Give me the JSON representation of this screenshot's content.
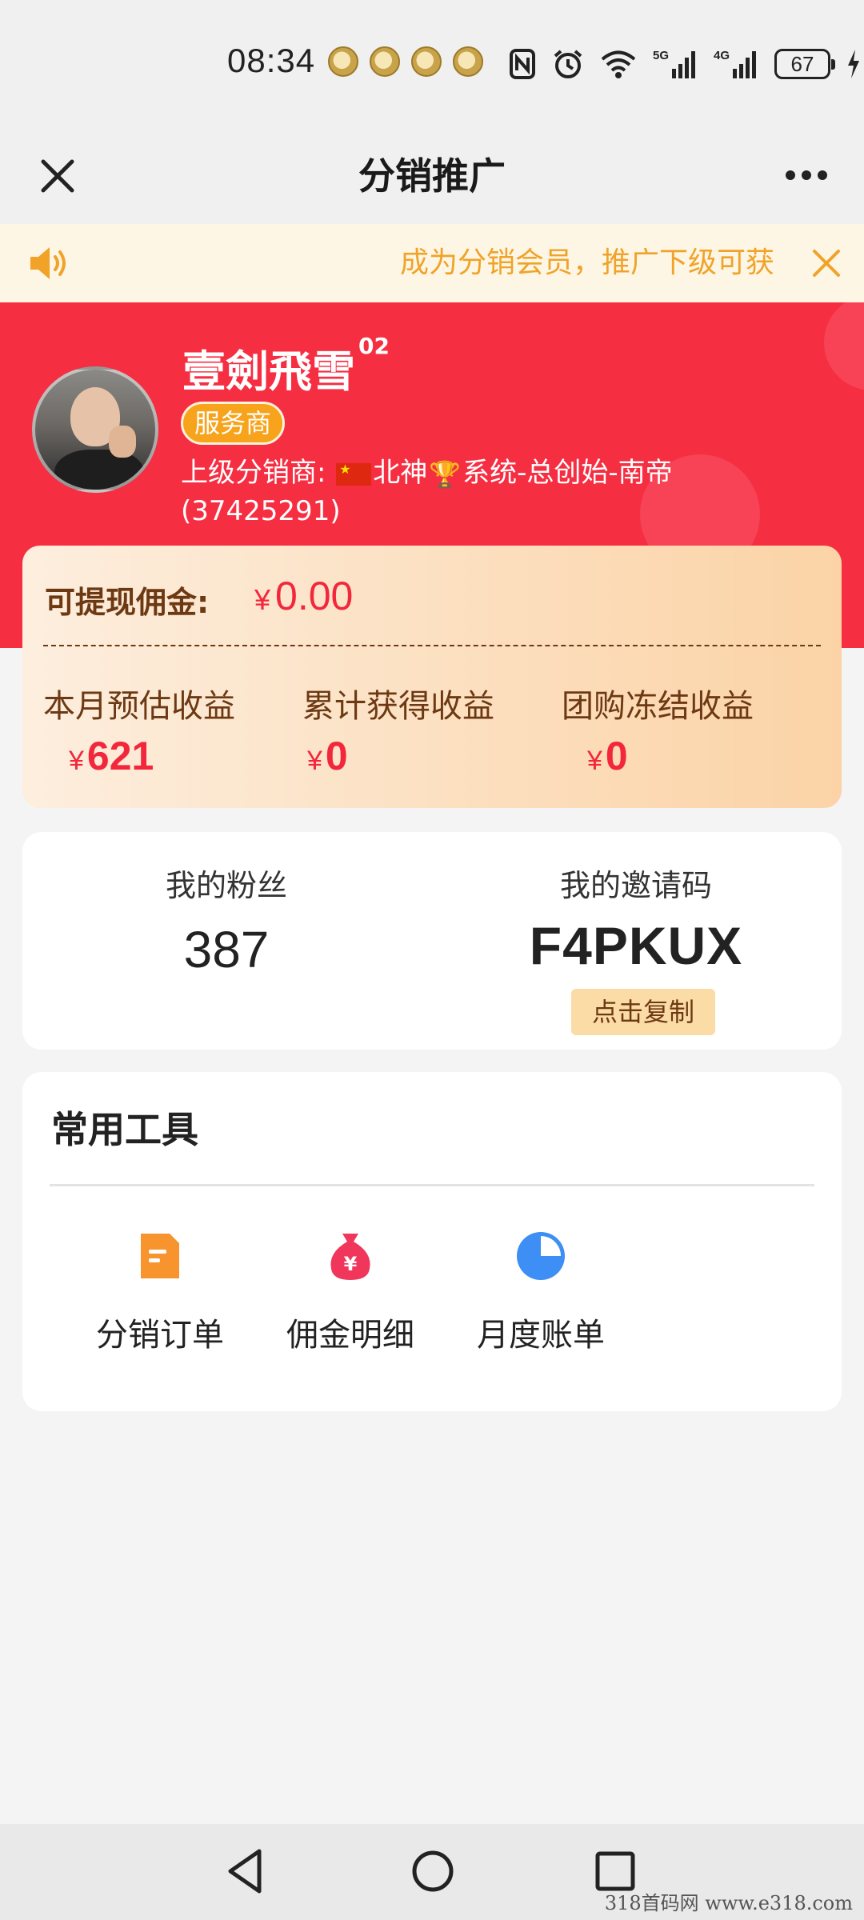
{
  "status_bar": {
    "time": "08:34",
    "battery": "67",
    "network_labels": [
      "5G",
      "4G"
    ]
  },
  "nav": {
    "title": "分销推广",
    "close_icon": "close-icon",
    "more_icon": "more-icon"
  },
  "notice": {
    "text": "成为分销会员，推广下级可获"
  },
  "profile": {
    "name": "壹劍飛雪",
    "name_suffix": "02",
    "role_badge": "服务商",
    "parent_label": "上级分销商:",
    "parent_name_part1": "北神",
    "parent_name_part2": "系统-总创始-南帝",
    "parent_id": "(37425291)"
  },
  "commission": {
    "withdraw_label": "可提现佣金:",
    "currency": "¥",
    "withdraw_value": "0.00",
    "stats": [
      {
        "label": "本月预估收益",
        "value": "621"
      },
      {
        "label": "累计获得收益",
        "value": "0"
      },
      {
        "label": "团购冻结收益",
        "value": "0"
      }
    ]
  },
  "fans": {
    "fans_label": "我的粉丝",
    "fans_count": "387",
    "invite_label": "我的邀请码",
    "invite_code": "F4PKUX",
    "copy_label": "点击复制"
  },
  "tools": {
    "title": "常用工具",
    "items": [
      {
        "label": "分销订单",
        "icon": "order-document-icon",
        "color": "#f7942e"
      },
      {
        "label": "佣金明细",
        "icon": "money-bag-icon",
        "color": "#f0365a"
      },
      {
        "label": "月度账单",
        "icon": "pie-chart-icon",
        "color": "#3d8ef5"
      }
    ]
  },
  "colors": {
    "header_red": "#f62e42",
    "notice_orange": "#f0a328",
    "accent_red": "#f3273c",
    "badge_orange": "#f7a31c"
  },
  "watermark": "318首码网 www.e318.com"
}
